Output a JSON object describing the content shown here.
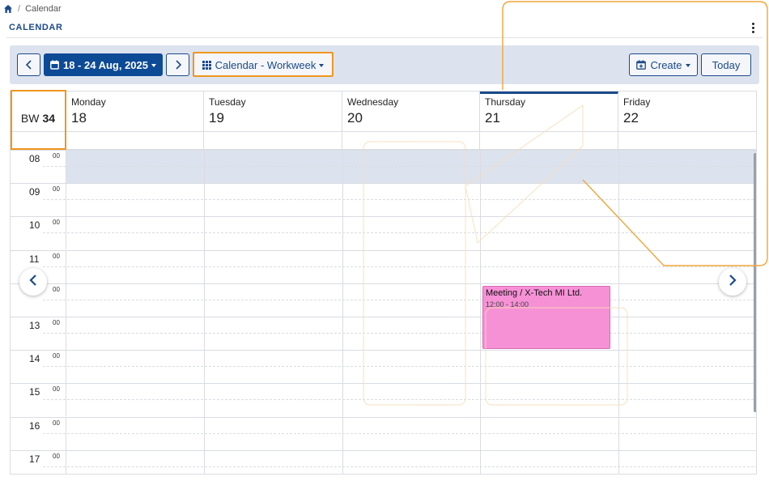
{
  "breadcrumb": {
    "home_icon": "home-icon",
    "separator": "/",
    "current": "Calendar"
  },
  "page": {
    "title": "CALENDAR"
  },
  "toolbar": {
    "date_range": "18 - 24 Aug, 2025",
    "view_label": "Calendar - Workweek",
    "create_label": "Create",
    "today_label": "Today",
    "icons": {
      "prev": "chevron-left-icon",
      "next": "chevron-right-icon",
      "calendar": "calendar-icon",
      "grid": "grid-icon",
      "create": "calendar-plus-icon",
      "more": "more-vertical-icon"
    }
  },
  "calendar": {
    "week_prefix": "BW",
    "week_number": "34",
    "days": [
      {
        "name": "Monday",
        "num": "18"
      },
      {
        "name": "Tuesday",
        "num": "19"
      },
      {
        "name": "Wednesday",
        "num": "20"
      },
      {
        "name": "Thursday",
        "num": "21"
      },
      {
        "name": "Friday",
        "num": "22"
      }
    ],
    "today_index": 3,
    "hours": [
      "08",
      "09",
      "10",
      "11",
      "",
      "13",
      "14",
      "15",
      "16",
      "17"
    ],
    "minutes_label": "00",
    "event": {
      "title": "Meeting / X-Tech MI Ltd.",
      "time": "12:00 - 14:00",
      "day": "Thursday"
    }
  },
  "colors": {
    "primary": "#0d4a96",
    "highlight": "#f0961e",
    "band": "#dde3ee",
    "event": "#f791d6"
  }
}
